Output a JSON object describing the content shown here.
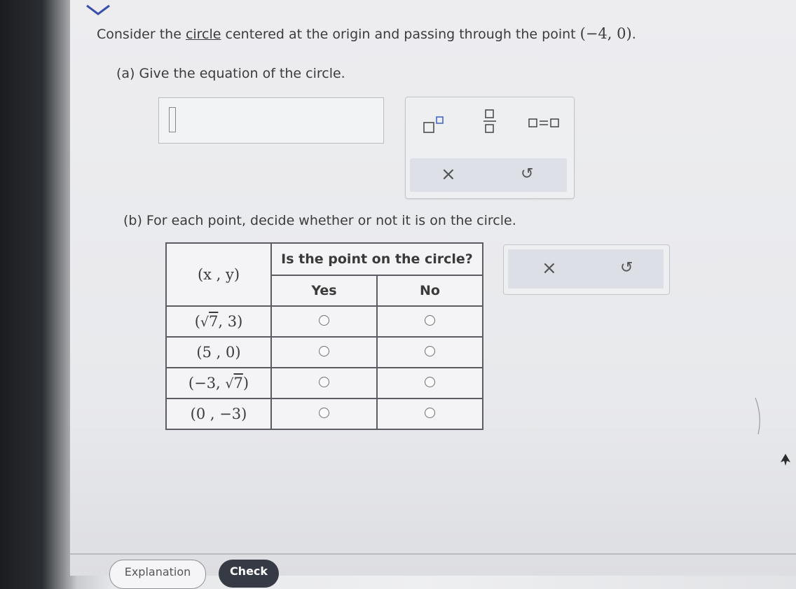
{
  "question": {
    "prefix": "Consider the ",
    "link_word": "circle",
    "middle": " centered at the origin and passing through the point ",
    "point": "(−4, 0)",
    "suffix": "."
  },
  "part_a": {
    "label": "(a) Give the equation of the circle."
  },
  "toolbar_a": {
    "superscript_icon": "superscript-icon",
    "fraction_icon": "fraction-icon",
    "equals_icon": "equals-template-icon",
    "clear_icon": "clear-icon",
    "undo_icon": "undo-icon",
    "clear_symbol": "×",
    "undo_symbol": "↺"
  },
  "part_b": {
    "label": "(b) For each point, decide whether or not it is on the circle."
  },
  "table": {
    "col_point": "(x , y)",
    "col_group": "Is the point on the circle?",
    "col_yes": "Yes",
    "col_no": "No",
    "rows": [
      {
        "point_pre": "(",
        "point_sqrt_a": "7",
        "point_mid": ", 3)",
        "selected": null
      },
      {
        "point": "(5 , 0)",
        "selected": null
      },
      {
        "point_pre": "(−3, ",
        "point_sqrt_b": "7",
        "point_post": ")",
        "selected": null
      },
      {
        "point": "(0 , −3)",
        "selected": null
      }
    ]
  },
  "toolbar_b": {
    "clear_symbol": "×",
    "undo_symbol": "↺"
  },
  "footer": {
    "explanation_label": "Explanation",
    "check_label": "Check"
  }
}
